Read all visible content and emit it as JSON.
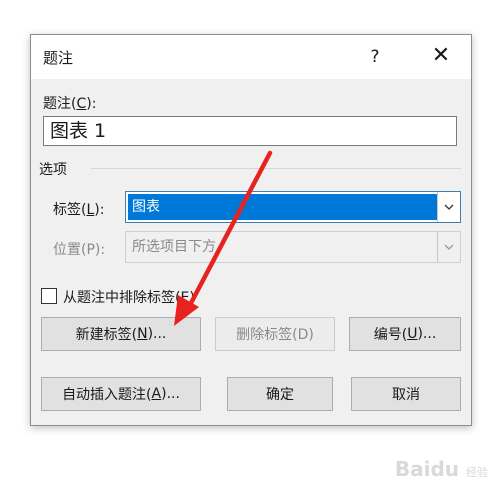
{
  "dialog": {
    "title": "题注",
    "help_label": "?",
    "close_label": "✕",
    "caption_label": "题注(",
    "caption_key": "C",
    "caption_label_end": "):",
    "caption_value": "图表 1",
    "options_group": "选项",
    "label_field_label": "标签(",
    "label_field_key": "L",
    "label_field_end": "):",
    "label_field_value": "图表",
    "position_label": "位置(P):",
    "position_value": "所选项目下方",
    "exclude_label_text": "从题注中排除标签(",
    "exclude_label_key": "E",
    "exclude_label_end": ")",
    "new_label_btn_text": "新建标签(",
    "new_label_btn_key": "N",
    "new_label_btn_end": ")...",
    "delete_label_btn": "删除标签(D)",
    "numbering_btn_text": "编号(",
    "numbering_btn_key": "U",
    "numbering_btn_end": ")...",
    "autocaption_btn_text": "自动插入题注(",
    "autocaption_btn_key": "A",
    "autocaption_btn_end": ")...",
    "ok_btn": "确定",
    "cancel_btn": "取消"
  },
  "watermark": {
    "main": "Baidu",
    "sub": "经验"
  },
  "colors": {
    "annotation_arrow": "#e8231f",
    "selection": "#0078d7"
  }
}
